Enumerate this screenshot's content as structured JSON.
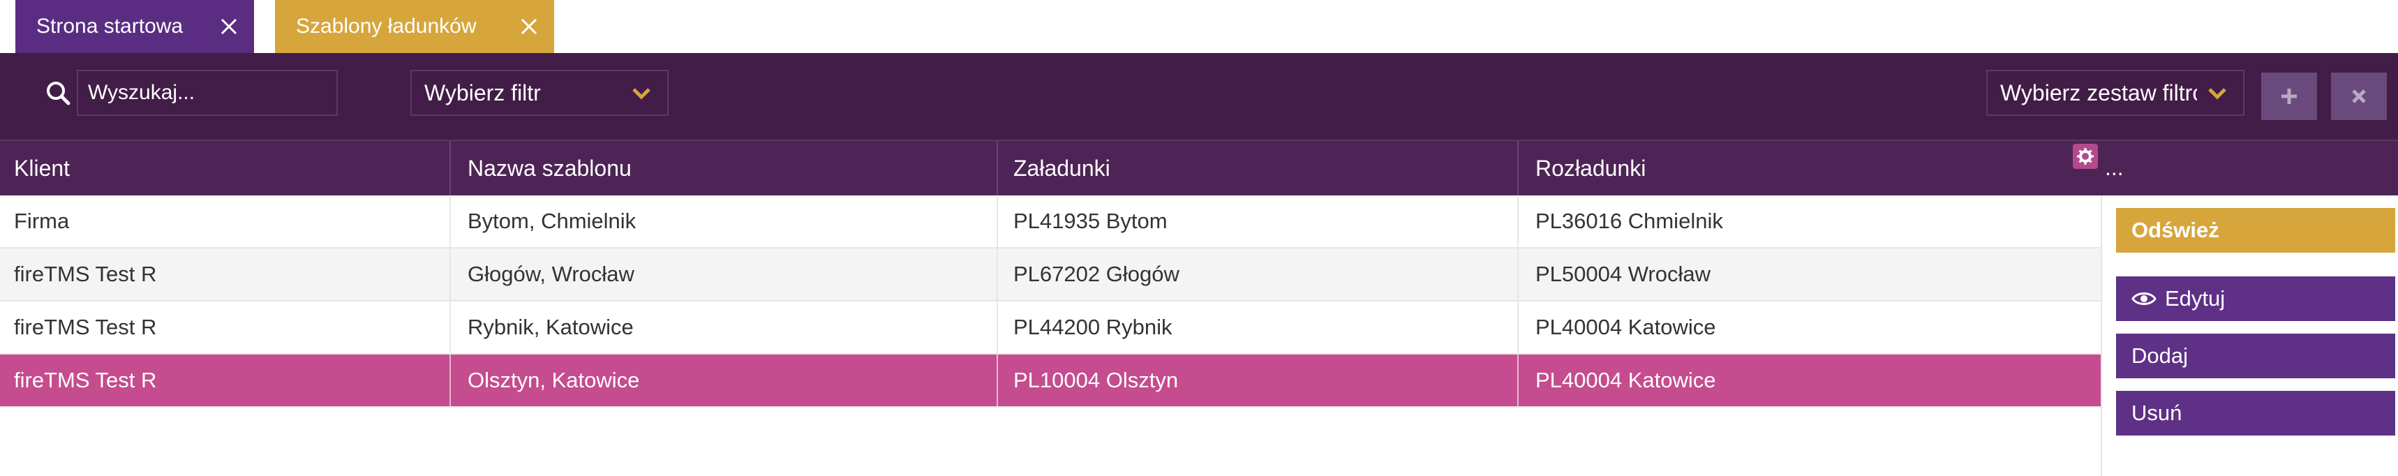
{
  "tabs": [
    {
      "label": "Strona startowa",
      "color": "#5a2d82"
    },
    {
      "label": "Szablony ładunków",
      "color": "#d6a63c"
    }
  ],
  "toolbar": {
    "search_placeholder": "Wyszukaj...",
    "filter_select": "Wybierz filtr",
    "filterset_select": "Wybierz zestaw filtrów",
    "add_icon": "plus-icon",
    "clear_icon": "x-icon"
  },
  "table": {
    "columns": [
      "Klient",
      "Nazwa szablonu",
      "Załadunki",
      "Rozładunki"
    ],
    "more": "...",
    "rows": [
      {
        "client": "Firma",
        "template": "Bytom, Chmielnik",
        "loading": "PL41935 Bytom",
        "unloading": "PL36016 Chmielnik"
      },
      {
        "client": "fireTMS Test R",
        "template": "Głogów, Wrocław",
        "loading": "PL67202 Głogów",
        "unloading": "PL50004 Wrocław"
      },
      {
        "client": "fireTMS Test R",
        "template": "Rybnik, Katowice",
        "loading": "PL44200 Rybnik",
        "unloading": "PL40004 Katowice"
      },
      {
        "client": "fireTMS Test R",
        "template": "Olsztyn, Katowice",
        "loading": "PL10004 Olsztyn",
        "unloading": "PL40004 Katowice"
      }
    ],
    "selected_row": 3
  },
  "actions": {
    "refresh": "Odśwież",
    "edit": "Edytuj",
    "add": "Dodaj",
    "delete": "Usuń"
  },
  "colors": {
    "toolbar_bg": "#421d47",
    "header_bg": "#4e2456",
    "accent_gold": "#d6a63c",
    "accent_purple": "#5e3186",
    "selected_row": "#c54c8e"
  }
}
